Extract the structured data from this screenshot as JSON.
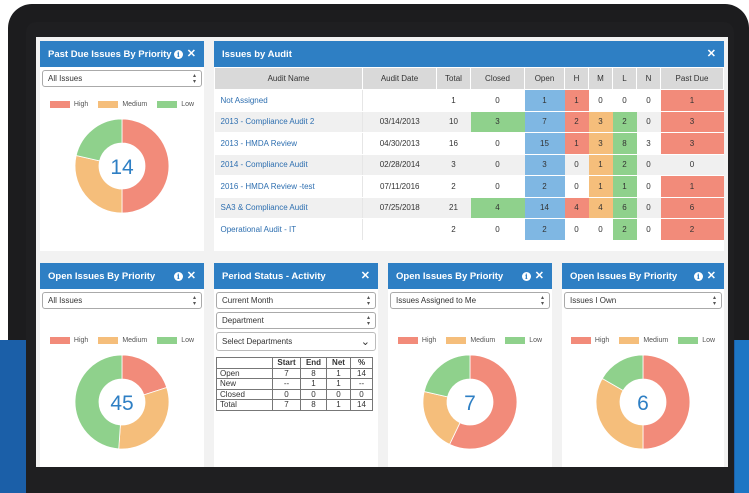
{
  "colors": {
    "high": "#f28b7a",
    "medium": "#f5be7b",
    "low": "#8fd18c",
    "header": "#2e7fc4"
  },
  "legend": {
    "high": "High",
    "medium": "Medium",
    "low": "Low"
  },
  "past_due": {
    "title": "Past Due Issues By Priority",
    "filter": "All Issues",
    "total": "14",
    "slices": {
      "high": 7,
      "medium": 4,
      "low": 3
    }
  },
  "issues_by_audit": {
    "title": "Issues by Audit",
    "columns": [
      "Audit Name",
      "Audit Date",
      "Total",
      "Closed",
      "Open",
      "H",
      "M",
      "L",
      "N",
      "Past Due"
    ],
    "rows": [
      {
        "name": "Not Assigned",
        "date": "",
        "total": "1",
        "closed": "0",
        "open": "1",
        "h": "1",
        "m": "0",
        "l": "0",
        "n": "0",
        "past_due": "1",
        "hl": [
          "open-b",
          "h-r",
          "pd-r"
        ]
      },
      {
        "name": "2013 - Compliance Audit 2",
        "date": "03/14/2013",
        "total": "10",
        "closed": "3",
        "open": "7",
        "h": "2",
        "m": "3",
        "l": "2",
        "n": "0",
        "past_due": "3",
        "hl": [
          "closed-g",
          "open-b",
          "h-r",
          "m-o",
          "l-g",
          "pd-r"
        ]
      },
      {
        "name": "2013 - HMDA Review",
        "date": "04/30/2013",
        "total": "16",
        "closed": "0",
        "open": "15",
        "h": "1",
        "m": "3",
        "l": "8",
        "n": "3",
        "past_due": "3",
        "hl": [
          "open-b",
          "h-r",
          "m-o",
          "l-g",
          "pd-r"
        ]
      },
      {
        "name": "2014 - Compliance Audit",
        "date": "02/28/2014",
        "total": "3",
        "closed": "0",
        "open": "3",
        "h": "0",
        "m": "1",
        "l": "2",
        "n": "0",
        "past_due": "0",
        "hl": [
          "open-b",
          "m-o",
          "l-g"
        ]
      },
      {
        "name": "2016 - HMDA Review -test",
        "date": "07/11/2016",
        "total": "2",
        "closed": "0",
        "open": "2",
        "h": "0",
        "m": "1",
        "l": "1",
        "n": "0",
        "past_due": "1",
        "hl": [
          "open-b",
          "m-o",
          "l-g",
          "pd-r"
        ]
      },
      {
        "name": "SA3 & Compliance Audit",
        "date": "07/25/2018",
        "total": "21",
        "closed": "4",
        "open": "14",
        "h": "4",
        "m": "4",
        "l": "6",
        "n": "0",
        "past_due": "6",
        "hl": [
          "closed-g",
          "open-b",
          "h-r",
          "m-o",
          "l-g",
          "pd-r"
        ]
      },
      {
        "name": "Operational Audit - IT",
        "date": "",
        "total": "2",
        "closed": "0",
        "open": "2",
        "h": "0",
        "m": "0",
        "l": "2",
        "n": "0",
        "past_due": "2",
        "hl": [
          "open-b",
          "l-g",
          "pd-r"
        ]
      }
    ]
  },
  "open_by_priority": {
    "title": "Open Issues By Priority",
    "filter": "All Issues",
    "total": "45",
    "slices": {
      "high": 9,
      "medium": 14,
      "low": 22
    }
  },
  "period_status": {
    "title": "Period Status - Activity",
    "period": "Current Month",
    "department": "Department",
    "departments": "Select Departments",
    "columns": [
      "",
      "Start",
      "End",
      "Net",
      "%"
    ],
    "rows": [
      [
        "Open",
        "7",
        "8",
        "1",
        "14"
      ],
      [
        "New",
        "--",
        "1",
        "1",
        "--"
      ],
      [
        "Closed",
        "0",
        "0",
        "0",
        "0"
      ],
      [
        "Total",
        "7",
        "8",
        "1",
        "14"
      ]
    ]
  },
  "assigned": {
    "title": "Open Issues By Priority",
    "filter": "Issues Assigned to Me",
    "total": "7",
    "slices": {
      "high": 4,
      "medium": 1.5,
      "low": 1.5
    }
  },
  "owned": {
    "title": "Open Issues By Priority",
    "filter": "Issues I Own",
    "total": "6",
    "slices": {
      "high": 3,
      "medium": 2,
      "low": 1
    }
  }
}
